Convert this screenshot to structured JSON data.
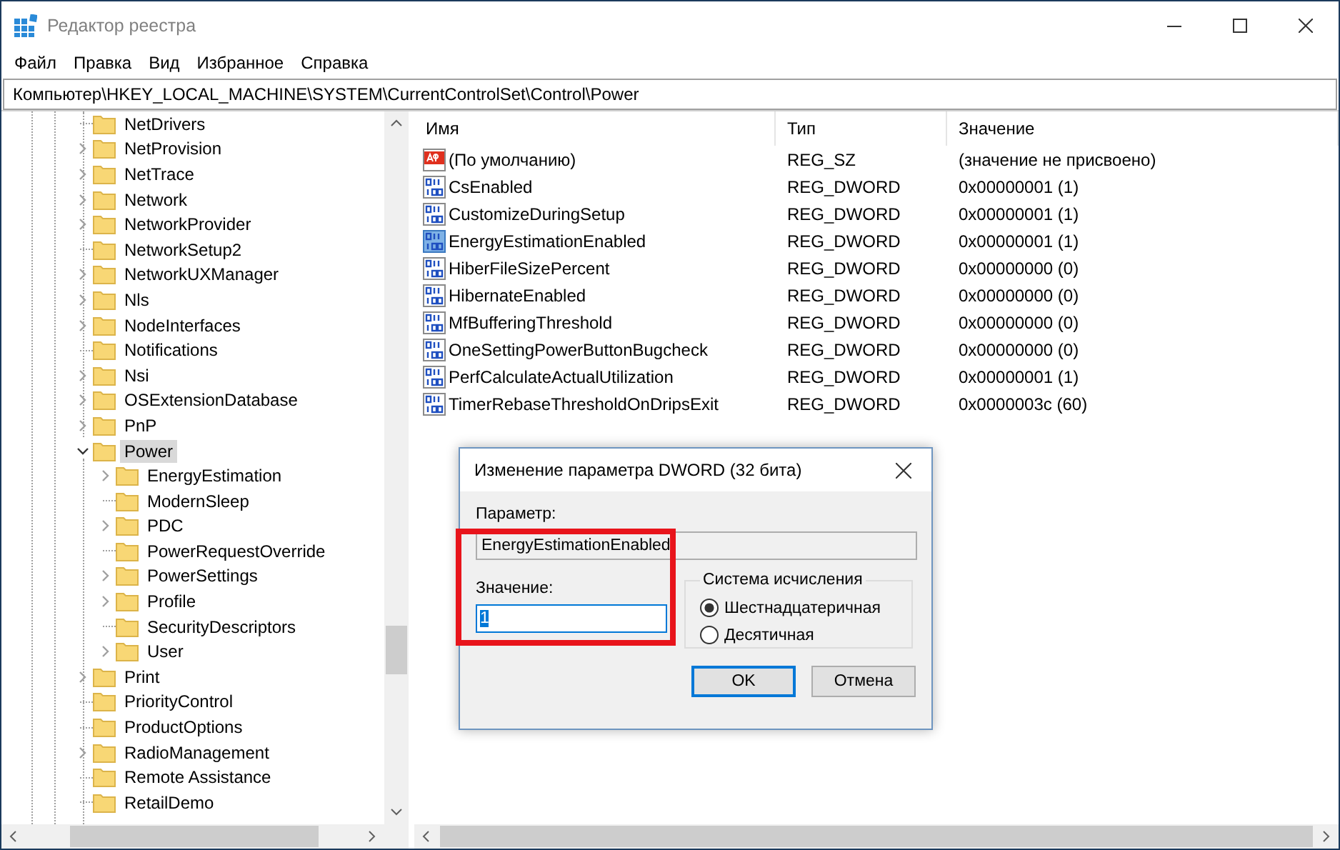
{
  "window": {
    "title": "Редактор реестра"
  },
  "menu": [
    "Файл",
    "Правка",
    "Вид",
    "Избранное",
    "Справка"
  ],
  "address": "Компьютер\\HKEY_LOCAL_MACHINE\\SYSTEM\\CurrentControlSet\\Control\\Power",
  "tree": [
    {
      "label": "NetDrivers",
      "expandable": false,
      "expanded": false,
      "selected": false
    },
    {
      "label": "NetProvision",
      "expandable": true,
      "expanded": false,
      "selected": false
    },
    {
      "label": "NetTrace",
      "expandable": true,
      "expanded": false,
      "selected": false
    },
    {
      "label": "Network",
      "expandable": true,
      "expanded": false,
      "selected": false
    },
    {
      "label": "NetworkProvider",
      "expandable": true,
      "expanded": false,
      "selected": false
    },
    {
      "label": "NetworkSetup2",
      "expandable": false,
      "expanded": false,
      "selected": false
    },
    {
      "label": "NetworkUXManager",
      "expandable": true,
      "expanded": false,
      "selected": false
    },
    {
      "label": "Nls",
      "expandable": true,
      "expanded": false,
      "selected": false
    },
    {
      "label": "NodeInterfaces",
      "expandable": true,
      "expanded": false,
      "selected": false
    },
    {
      "label": "Notifications",
      "expandable": false,
      "expanded": false,
      "selected": false
    },
    {
      "label": "Nsi",
      "expandable": true,
      "expanded": false,
      "selected": false
    },
    {
      "label": "OSExtensionDatabase",
      "expandable": true,
      "expanded": false,
      "selected": false
    },
    {
      "label": "PnP",
      "expandable": true,
      "expanded": false,
      "selected": false
    },
    {
      "label": "Power",
      "expandable": true,
      "expanded": true,
      "selected": true,
      "children": [
        {
          "label": "EnergyEstimation",
          "expandable": true,
          "expanded": false,
          "selected": false
        },
        {
          "label": "ModernSleep",
          "expandable": false,
          "expanded": false,
          "selected": false
        },
        {
          "label": "PDC",
          "expandable": true,
          "expanded": false,
          "selected": false
        },
        {
          "label": "PowerRequestOverride",
          "expandable": false,
          "expanded": false,
          "selected": false
        },
        {
          "label": "PowerSettings",
          "expandable": true,
          "expanded": false,
          "selected": false
        },
        {
          "label": "Profile",
          "expandable": true,
          "expanded": false,
          "selected": false
        },
        {
          "label": "SecurityDescriptors",
          "expandable": false,
          "expanded": false,
          "selected": false
        },
        {
          "label": "User",
          "expandable": true,
          "expanded": false,
          "selected": false
        }
      ]
    },
    {
      "label": "Print",
      "expandable": true,
      "expanded": false,
      "selected": false
    },
    {
      "label": "PriorityControl",
      "expandable": false,
      "expanded": false,
      "selected": false
    },
    {
      "label": "ProductOptions",
      "expandable": false,
      "expanded": false,
      "selected": false
    },
    {
      "label": "RadioManagement",
      "expandable": true,
      "expanded": false,
      "selected": false
    },
    {
      "label": "Remote Assistance",
      "expandable": false,
      "expanded": false,
      "selected": false
    },
    {
      "label": "RetailDemo",
      "expandable": false,
      "expanded": false,
      "selected": false
    }
  ],
  "list": {
    "columns": [
      "Имя",
      "Тип",
      "Значение"
    ],
    "rows": [
      {
        "kind": "string",
        "name": "(По умолчанию)",
        "type": "REG_SZ",
        "value": "(значение не присвоено)",
        "selected": false
      },
      {
        "kind": "dword",
        "name": "CsEnabled",
        "type": "REG_DWORD",
        "value": "0x00000001 (1)",
        "selected": false
      },
      {
        "kind": "dword",
        "name": "CustomizeDuringSetup",
        "type": "REG_DWORD",
        "value": "0x00000001 (1)",
        "selected": false
      },
      {
        "kind": "dword",
        "name": "EnergyEstimationEnabled",
        "type": "REG_DWORD",
        "value": "0x00000001 (1)",
        "selected": true
      },
      {
        "kind": "dword",
        "name": "HiberFileSizePercent",
        "type": "REG_DWORD",
        "value": "0x00000000 (0)",
        "selected": false
      },
      {
        "kind": "dword",
        "name": "HibernateEnabled",
        "type": "REG_DWORD",
        "value": "0x00000000 (0)",
        "selected": false
      },
      {
        "kind": "dword",
        "name": "MfBufferingThreshold",
        "type": "REG_DWORD",
        "value": "0x00000000 (0)",
        "selected": false
      },
      {
        "kind": "dword",
        "name": "OneSettingPowerButtonBugcheck",
        "type": "REG_DWORD",
        "value": "0x00000000 (0)",
        "selected": false
      },
      {
        "kind": "dword",
        "name": "PerfCalculateActualUtilization",
        "type": "REG_DWORD",
        "value": "0x00000001 (1)",
        "selected": false
      },
      {
        "kind": "dword",
        "name": "TimerRebaseThresholdOnDripsExit",
        "type": "REG_DWORD",
        "value": "0x0000003c (60)",
        "selected": false
      }
    ]
  },
  "dialog": {
    "title": "Изменение параметра DWORD (32 бита)",
    "name_label": "Параметр:",
    "name_value": "EnergyEstimationEnabled",
    "value_label": "Значение:",
    "value": "1",
    "value_selected": true,
    "base_label": "Система исчисления",
    "bases": [
      {
        "label": "Шестнадцатеричная",
        "selected": true
      },
      {
        "label": "Десятичная",
        "selected": false
      }
    ],
    "buttons": [
      {
        "label": "OK",
        "default": true
      },
      {
        "label": "Отмена",
        "default": false
      }
    ]
  }
}
